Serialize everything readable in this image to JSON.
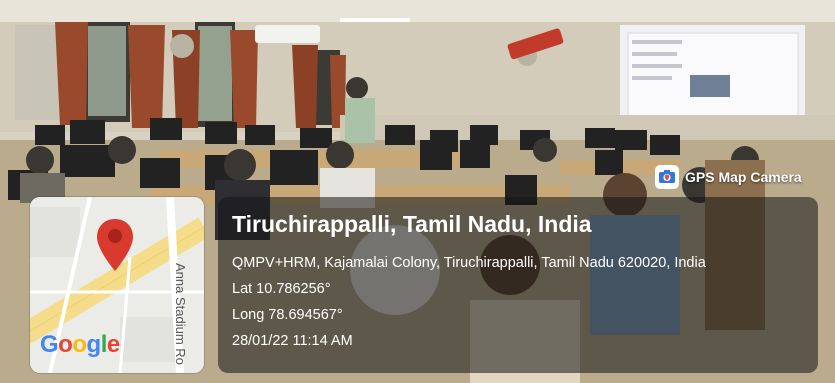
{
  "map": {
    "road_label": "Anna Stadium Ro",
    "logo": "Google",
    "pin_icon": "map-pin-icon"
  },
  "badge": {
    "label": "GPS Map Camera",
    "icon": "gps-camera-icon"
  },
  "location": {
    "title": "Tiruchirappalli, Tamil Nadu, India",
    "address": "QMPV+HRM, Kajamalai Colony, Tiruchirappalli, Tamil Nadu 620020, India",
    "latitude": "Lat 10.786256°",
    "longitude": "Long 78.694567°",
    "timestamp": "28/01/22 11:14 AM"
  },
  "colors": {
    "pin": "#d93a2e",
    "info_panel": "#2a2a2a",
    "map_road_major": "#f4dc8a",
    "map_background": "#ebebe8"
  }
}
